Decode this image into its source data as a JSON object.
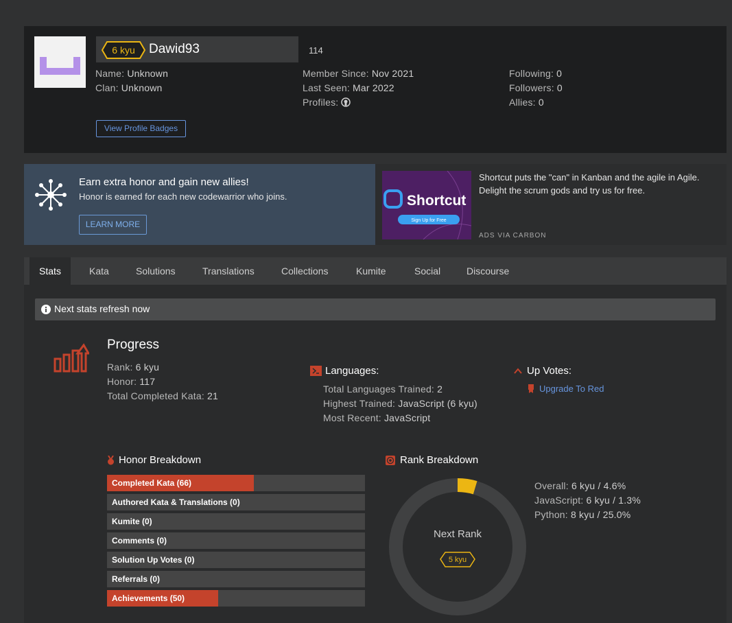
{
  "profile": {
    "rank": "6 kyu",
    "username": "Dawid93",
    "honor": "114",
    "name_label": "Name:",
    "name_value": "Unknown",
    "clan_label": "Clan:",
    "clan_value": "Unknown",
    "member_since_label": "Member Since:",
    "member_since_value": "Nov 2021",
    "last_seen_label": "Last Seen:",
    "last_seen_value": "Mar 2022",
    "profiles_label": "Profiles:",
    "following_label": "Following:",
    "following_value": "0",
    "followers_label": "Followers:",
    "followers_value": "0",
    "allies_label": "Allies:",
    "allies_value": "0",
    "badges_button": "View Profile Badges"
  },
  "referral": {
    "title": "Earn extra honor and gain new allies!",
    "subtitle": "Honor is earned for each new codewarrior who joins.",
    "button": "LEARN MORE"
  },
  "ad": {
    "brand": "Shortcut",
    "cta": "Sign Up for Free",
    "text": "Shortcut puts the \"can\" in Kanban and the agile in Agile. Delight the scrum gods and try us for free.",
    "via": "ADS VIA CARBON"
  },
  "tabs": [
    "Stats",
    "Kata",
    "Solutions",
    "Translations",
    "Collections",
    "Kumite",
    "Social",
    "Discourse"
  ],
  "notice": "Next stats refresh now",
  "progress": {
    "title": "Progress",
    "rank_label": "Rank:",
    "rank_value": "6 kyu",
    "honor_label": "Honor:",
    "honor_value": "117",
    "completed_label": "Total Completed Kata:",
    "completed_value": "21"
  },
  "languages": {
    "title": "Languages:",
    "trained_label": "Total Languages Trained:",
    "trained_value": "2",
    "highest_label": "Highest Trained:",
    "highest_value": "JavaScript (6 kyu)",
    "recent_label": "Most Recent:",
    "recent_value": "JavaScript"
  },
  "upvotes": {
    "title": "Up Votes:",
    "link": "Upgrade To Red"
  },
  "honor_breakdown": {
    "title": "Honor Breakdown",
    "bars": [
      {
        "label": "Completed Kata (66)",
        "fraction": 0.57
      },
      {
        "label": "Authored Kata & Translations (0)",
        "fraction": 0
      },
      {
        "label": "Kumite (0)",
        "fraction": 0
      },
      {
        "label": "Comments (0)",
        "fraction": 0
      },
      {
        "label": "Solution Up Votes (0)",
        "fraction": 0
      },
      {
        "label": "Referrals (0)",
        "fraction": 0
      },
      {
        "label": "Achievements (50)",
        "fraction": 0.43
      }
    ]
  },
  "rank_breakdown": {
    "title": "Rank Breakdown",
    "next_rank_label": "Next Rank",
    "next_rank": "5 kyu",
    "progress_percent": 4.6,
    "overall_label": "Overall:",
    "overall_value": "6 kyu / 4.6%",
    "js_label": "JavaScript:",
    "js_value": "6 kyu / 1.3%",
    "py_label": "Python:",
    "py_value": "8 kyu / 25.0%"
  },
  "colors": {
    "accent_red": "#c4432c",
    "rank_yellow": "#ecb613",
    "link_blue": "#6795de"
  }
}
